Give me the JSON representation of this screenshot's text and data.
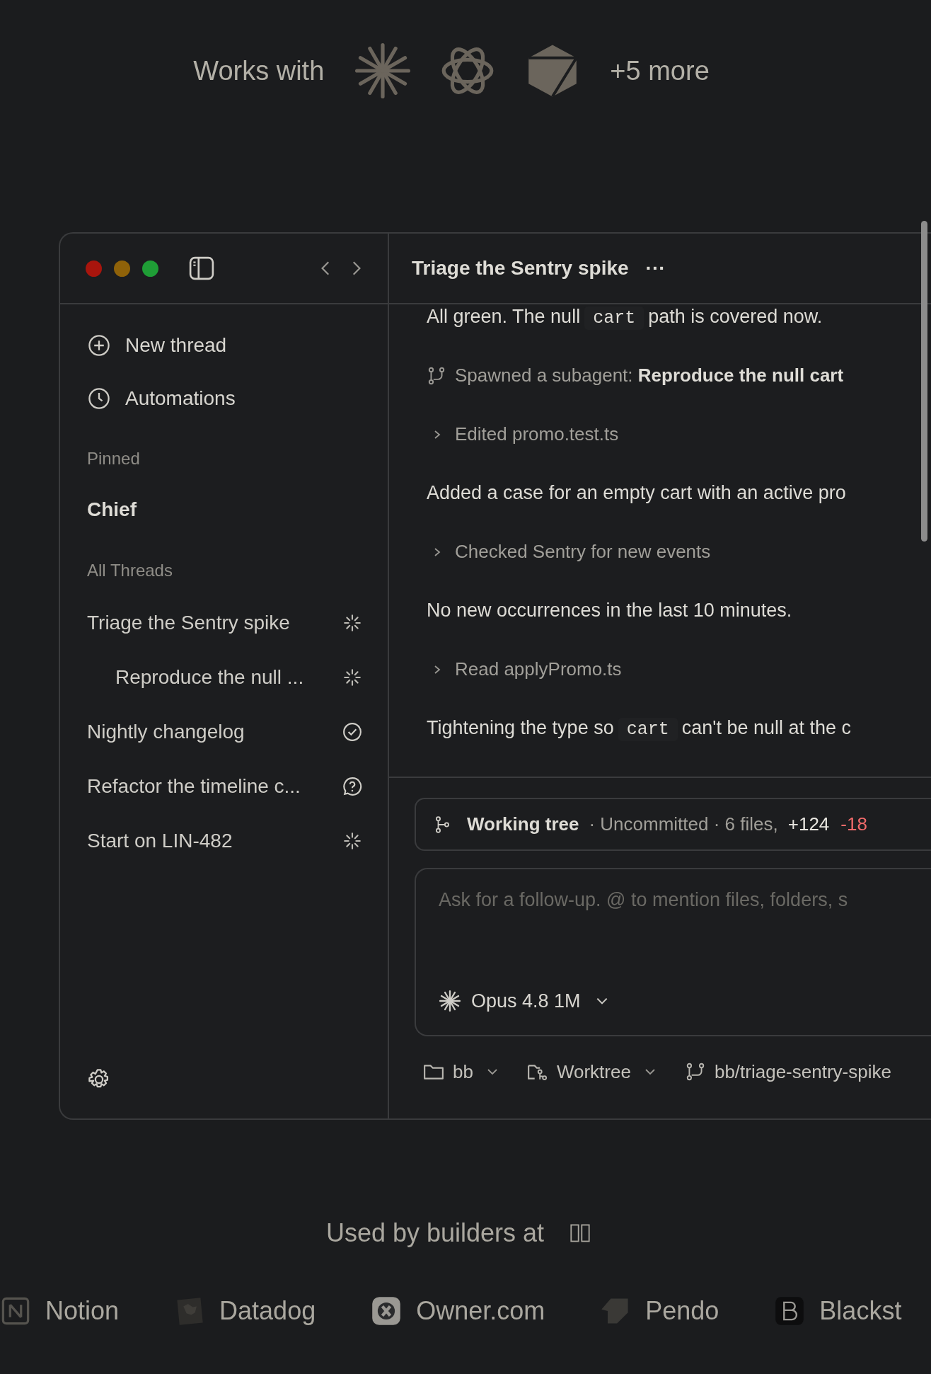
{
  "works_with": {
    "label": "Works with",
    "more": "+5 more"
  },
  "window": {
    "title": "Triage the Sentry spike",
    "more_button": "···"
  },
  "sidebar": {
    "actions": [
      {
        "label": "New thread",
        "kind": "new"
      },
      {
        "label": "Automations",
        "kind": "clock"
      }
    ],
    "pinned": {
      "heading": "Pinned",
      "items": [
        {
          "label": "Chief"
        }
      ]
    },
    "threads": {
      "heading": "All Threads",
      "items": [
        {
          "label": "Triage the Sentry spike",
          "kind": "running",
          "children": [
            {
              "label": "Reproduce the null ...",
              "kind": "running"
            }
          ]
        },
        {
          "label": "Nightly changelog",
          "kind": "done"
        },
        {
          "label": "Refactor the timeline c...",
          "kind": "question"
        },
        {
          "label": "Start on LIN-482",
          "kind": "running"
        }
      ]
    }
  },
  "messages": [
    {
      "kind": "text",
      "parts": [
        {
          "text": "All green. The null"
        },
        {
          "code": "cart"
        },
        {
          "text": "path is covered now."
        }
      ]
    },
    {
      "kind": "spawn",
      "text": "Spawned a subagent: **Reproduce the null cart**"
    },
    {
      "kind": "tool",
      "text": "Edited promo.test.ts"
    },
    {
      "kind": "text",
      "parts": [
        {
          "text": "Added a case for an empty cart with an active pro"
        }
      ]
    },
    {
      "kind": "tool",
      "text": "Checked Sentry for new events"
    },
    {
      "kind": "text",
      "parts": [
        {
          "text": "No new occurrences in the last 10 minutes."
        }
      ]
    },
    {
      "kind": "tool",
      "text": "Read applyPromo.ts"
    },
    {
      "kind": "text",
      "parts": [
        {
          "text": "Tightening the type so"
        },
        {
          "code": "cart"
        },
        {
          "text": "can't be null at the c"
        }
      ]
    }
  ],
  "working_tree": {
    "title": "Working tree",
    "meta": "· Uncommitted · 6 files,",
    "added": "+124",
    "removed": "-18"
  },
  "composer": {
    "placeholder": "Ask for a follow-up. @ to mention files, folders, s",
    "model": "Opus 4.8 1M"
  },
  "footer": [
    {
      "kind": "folder",
      "label": "bb"
    },
    {
      "kind": "worktree",
      "label": "Worktree"
    },
    {
      "kind": "branch",
      "label": "bb/triage-sentry-spike"
    }
  ],
  "used_by": {
    "label": "Used by builders at",
    "logos": [
      {
        "name": "Notion",
        "kind": "notion"
      },
      {
        "name": "Datadog",
        "kind": "datadog"
      },
      {
        "name": "Owner.com",
        "kind": "owner"
      },
      {
        "name": "Pendo",
        "kind": "pendo"
      },
      {
        "name": "Blackst",
        "kind": "b"
      }
    ]
  }
}
